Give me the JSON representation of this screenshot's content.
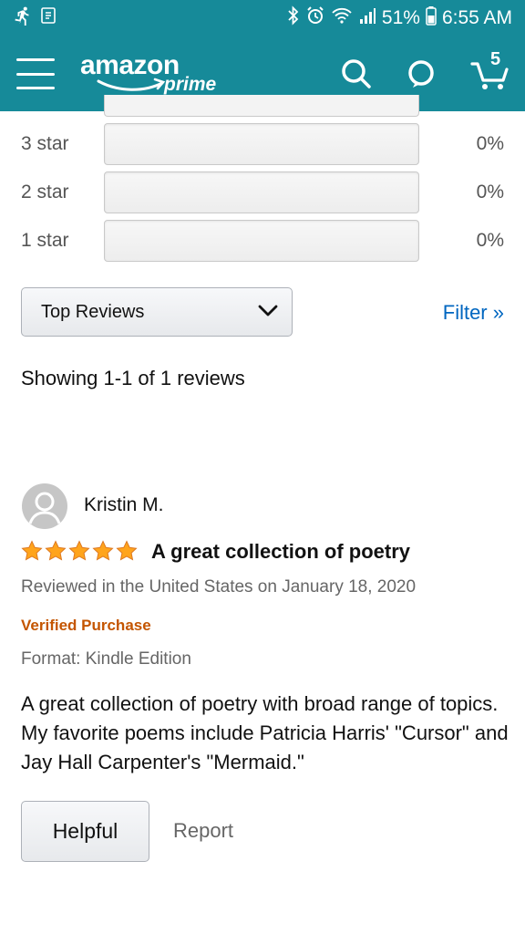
{
  "status_bar": {
    "battery_percent": "51%",
    "time": "6:55 AM"
  },
  "header": {
    "logo_word": "amazon",
    "logo_sub": "prime",
    "cart_count": "5",
    "colors": {
      "background": "#168a99"
    }
  },
  "ratings": [
    {
      "label": "3 star",
      "percent": "0%",
      "fill_fraction": 0
    },
    {
      "label": "2 star",
      "percent": "0%",
      "fill_fraction": 0
    },
    {
      "label": "1 star",
      "percent": "0%",
      "fill_fraction": 0
    }
  ],
  "sort": {
    "selected": "Top Reviews"
  },
  "filter": {
    "label": "Filter »"
  },
  "showing_text": "Showing 1-1 of 1 reviews",
  "review": {
    "reviewer": "Kristin M.",
    "stars": 5,
    "title": "A great collection of poetry",
    "meta": "Reviewed in the United States on January 18, 2020",
    "verified": "Verified Purchase",
    "format": "Format: Kindle Edition",
    "body": "A great collection of poetry with broad range of topics. My favorite poems include Patricia Harris' \"Cursor\" and Jay Hall Carpenter's \"Mermaid.\"",
    "helpful_label": "Helpful",
    "report_label": "Report"
  }
}
